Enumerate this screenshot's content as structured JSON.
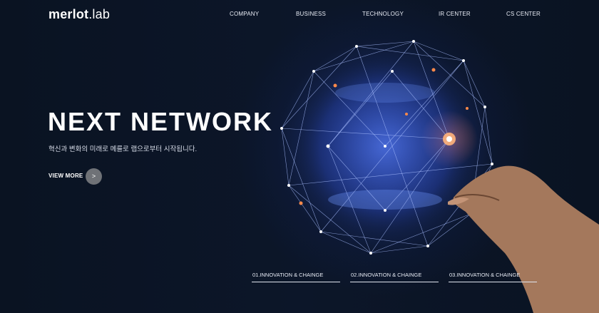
{
  "brand": {
    "logo_main": "merlot",
    "logo_suffix": ".lab"
  },
  "nav": {
    "items": [
      "COMPANY",
      "BUSINESS",
      "TECHNOLOGY",
      "IR CENTER",
      "CS CENTER"
    ]
  },
  "hero": {
    "headline": "NEXT NETWORK",
    "subtitle": "혁신과 변화의 미래로 메를로 랩으로부터 시작됩니다.",
    "cta_label": "VIEW MORE",
    "cta_icon": "chevron-right-icon",
    "cta_glyph": ">"
  },
  "tabs": [
    {
      "label": "01.INNOVATION & CHAINGE"
    },
    {
      "label": "02.INNOVATION & CHAINGE"
    },
    {
      "label": "03.INNOVATION & CHAINGE"
    }
  ],
  "colors": {
    "background": "#0b1426",
    "network_glow": "#4a6fff",
    "spark": "#ff8a4a",
    "cta_circle": "#6f7277"
  }
}
